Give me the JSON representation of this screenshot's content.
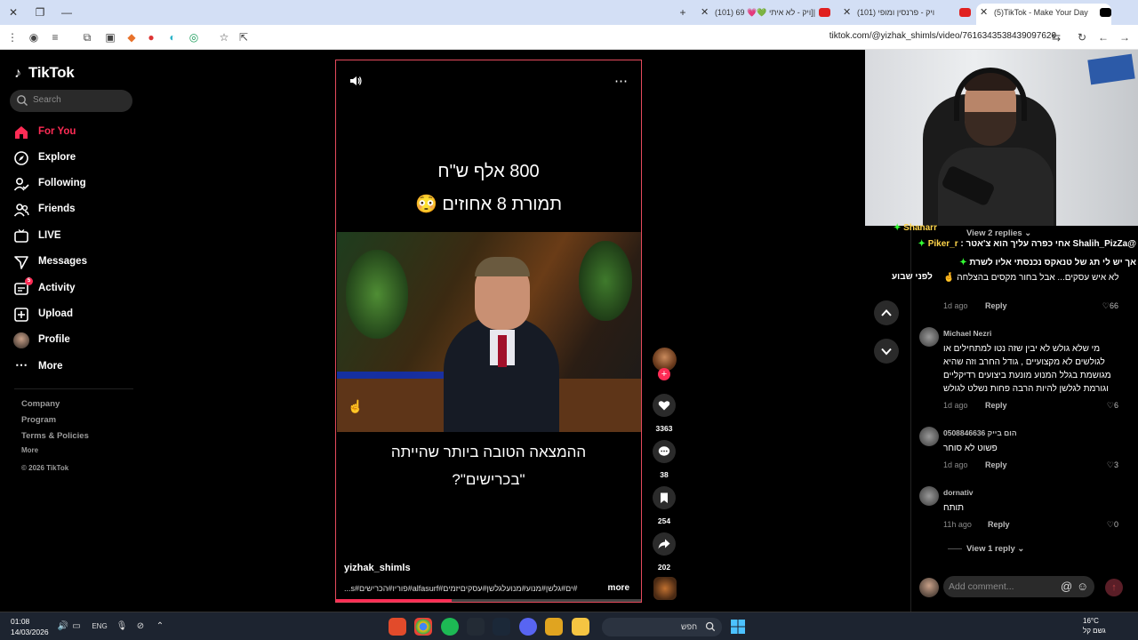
{
  "browser": {
    "url": "tiktok.com/@yizhak_shimls/video/7616343538439097620",
    "tabs": [
      {
        "title": "(5)TikTok - Make Your Day",
        "active": true
      },
      {
        "title": "(101) ויק - פרנסין ומופי",
        "active": false
      },
      {
        "title": "(101) ויק - לא איתי 💚💗 69]|",
        "active": false
      }
    ]
  },
  "sidebar": {
    "logo": "TikTok",
    "search_placeholder": "Search",
    "items": [
      {
        "label": "For You",
        "icon": "home-icon"
      },
      {
        "label": "Explore",
        "icon": "compass-icon"
      },
      {
        "label": "Following",
        "icon": "following-icon"
      },
      {
        "label": "Friends",
        "icon": "friends-icon"
      },
      {
        "label": "LIVE",
        "icon": "live-icon"
      },
      {
        "label": "Messages",
        "icon": "messages-icon"
      },
      {
        "label": "Activity",
        "icon": "activity-icon",
        "badge": "5"
      },
      {
        "label": "Upload",
        "icon": "upload-icon"
      },
      {
        "label": "Profile",
        "icon": "profile-avatar"
      },
      {
        "label": "More",
        "icon": "more-icon"
      }
    ],
    "footer": {
      "company": "Company",
      "program": "Program",
      "terms": "Terms & Policies",
      "more": "More",
      "copyright": "© 2026 TikTok"
    }
  },
  "video": {
    "headline_1": "800 אלף ש\"ח",
    "headline_2": "תמורת 8 אחוזים 😳",
    "caption_1": "ההמצאה הטובה ביותר שהייתה",
    "caption_2": "\"בכרישים\"?",
    "username": "yizhak_shimls",
    "hashtags": "#ים#גלשן#מנוע#מנועלגלשן#עסקיםיזמים#alfasurf#פוריו#הכרישים",
    "hashtags_suffix": "#s...",
    "more_label": "more",
    "progress": 0.38
  },
  "actions": {
    "likes": "3363",
    "comments": "38",
    "saves": "254",
    "shares": "202"
  },
  "chat": [
    {
      "name": "Shanarr",
      "text": ""
    },
    {
      "name": "Piker_r",
      "text": "@Shalih_PizZa אחי כפרה עליך הוא צ'אטר"
    },
    {
      "name": "",
      "text": "אך יש לי תג של טנאקס נכנסתי אליו לשרת"
    }
  ],
  "comments": {
    "view_replies_top": "View 2 replies",
    "thread_tail_text": "לא איש עסקים... אבל בחור מקסים בהצלחה 🤞",
    "thread_tail_meta": {
      "time": "1d ago",
      "reply": "Reply",
      "likes": "66"
    },
    "items": [
      {
        "name": "Michael Nezri",
        "lines": [
          "מי שלא גולש לא יבין שזה נטו למתחילים או",
          "לגולשים לא מקצועיים , גודל החרב וזה שהיא",
          "מגושמת בגלל המנוע מונעת ביצועים רדיקליים",
          "וגורמת לגלשן להיות הרבה פחות נשלט לגולש"
        ],
        "time": "1d ago",
        "reply": "Reply",
        "likes": "6"
      },
      {
        "name": "0508846636 הום בייק",
        "lines": [
          "פשוט לא סוחר"
        ],
        "time": "1d ago",
        "reply": "Reply",
        "likes": "3"
      },
      {
        "name": "dornativ",
        "lines": [
          "תותח"
        ],
        "time": "11h ago",
        "reply": "Reply",
        "likes": "0"
      }
    ],
    "view_reply_bottom": "View 1 reply",
    "add_placeholder": "Add comment...",
    "chat_side_text": "לפני שבוע"
  },
  "taskbar": {
    "time": "01:08",
    "date": "14/03/2026",
    "lang": "ENG",
    "search_text": "חפש",
    "temp": "16°C",
    "weather": "גשם קל"
  },
  "colors": {
    "accent": "#fe2c55",
    "video_border": "#e54a5c"
  }
}
